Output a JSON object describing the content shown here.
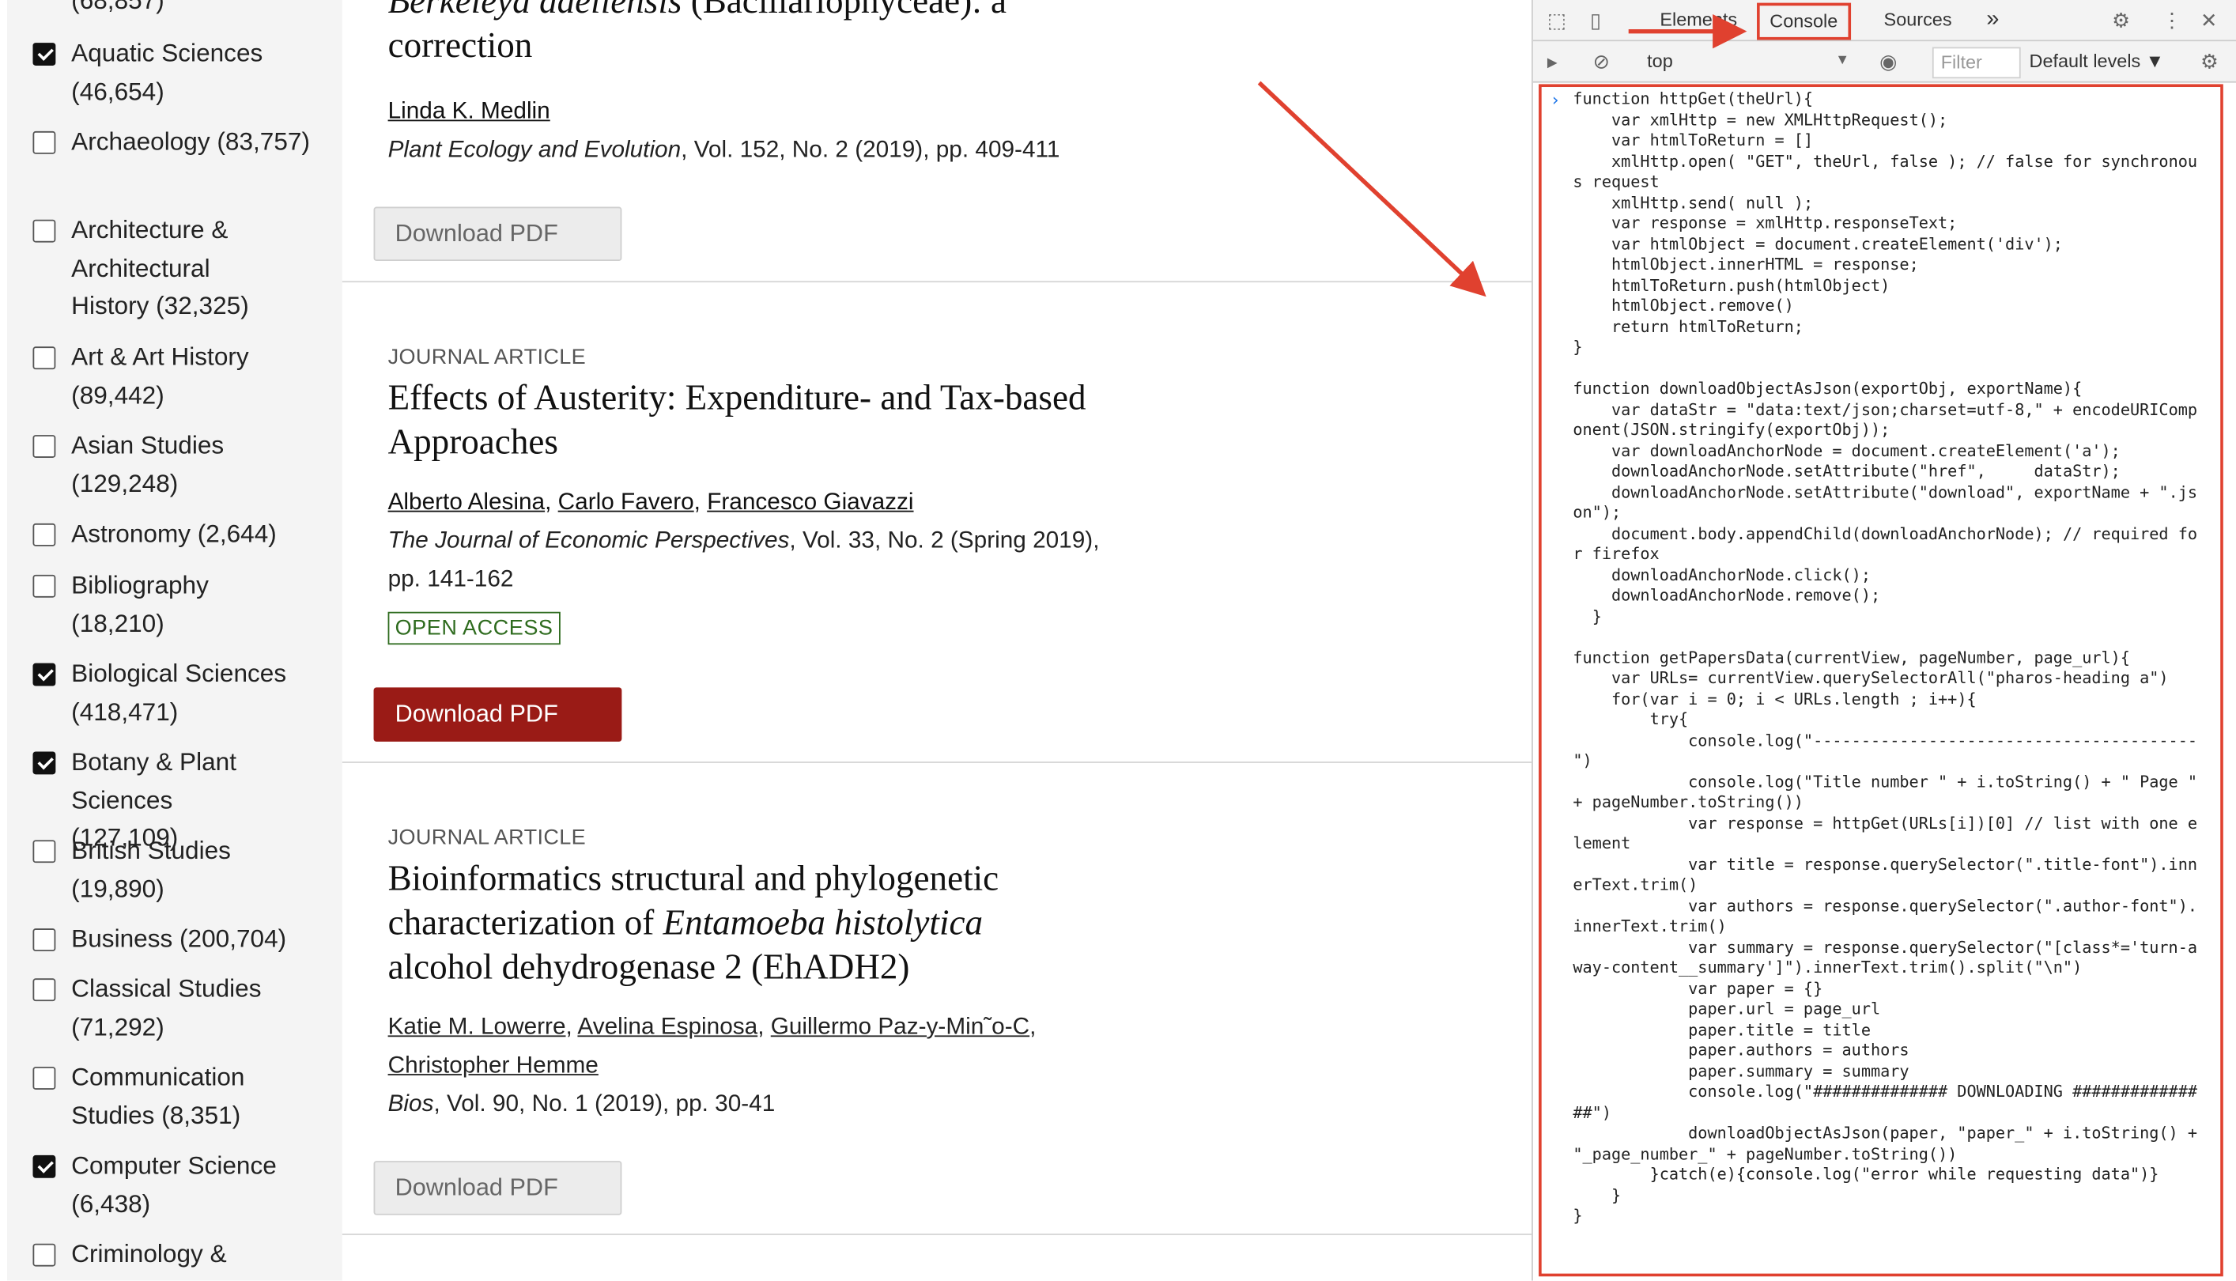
{
  "sidebar": {
    "filters": [
      {
        "label": "(68,857)",
        "checked": true
      },
      {
        "label": "Aquatic Sciences (46,654)",
        "checked": true
      },
      {
        "label": "Archaeology (83,757)",
        "checked": false
      },
      {
        "label": "Architecture & Architectural History (32,325)",
        "checked": false
      },
      {
        "label": "Art & Art History (89,442)",
        "checked": false
      },
      {
        "label": "Asian Studies (129,248)",
        "checked": false
      },
      {
        "label": "Astronomy (2,644)",
        "checked": false
      },
      {
        "label": "Bibliography (18,210)",
        "checked": false
      },
      {
        "label": "Biological Sciences (418,471)",
        "checked": true
      },
      {
        "label": "Botany & Plant Sciences (127,109)",
        "checked": true
      },
      {
        "label": "British Studies (19,890)",
        "checked": false
      },
      {
        "label": "Business (200,704)",
        "checked": false
      },
      {
        "label": "Classical Studies (71,292)",
        "checked": false
      },
      {
        "label": "Communication Studies (8,351)",
        "checked": false
      },
      {
        "label": "Computer Science (6,438)",
        "checked": true
      },
      {
        "label": "Criminology &",
        "checked": false
      }
    ]
  },
  "results": [
    {
      "title_italic": "Berkeleya adeliensis",
      "title_rest": " (Bacillariophyceae): a correction",
      "authors": [
        "Linda K. Medlin"
      ],
      "journal": "Plant Ecology and Evolution",
      "cite_rest": ", Vol. 152, No. 2 (2019), pp. 409-411",
      "download_label": "Download PDF"
    },
    {
      "kind": "JOURNAL ARTICLE",
      "title": "Effects of Austerity: Expenditure- and Tax-based Approaches",
      "authors": [
        "Alberto Alesina",
        "Carlo Favero",
        "Francesco Giavazzi"
      ],
      "journal": "The Journal of Economic Perspectives",
      "cite_rest": ", Vol. 33, No. 2 (Spring 2019), pp. 141-162",
      "badge": "OPEN ACCESS",
      "download_label": "Download PDF"
    },
    {
      "kind": "JOURNAL ARTICLE",
      "title_before": "Bioinformatics structural and phylogenetic characterization of ",
      "title_italic": "Entamoeba histolytica",
      "title_after": " alcohol dehydrogenase 2 (EhADH2)",
      "authors": [
        "Katie M. Lowerre",
        "Avelina Espinosa",
        "Guillermo Paz-y-Min˜o-C",
        "Christopher Hemme"
      ],
      "journal": "Bios",
      "cite_rest": ", Vol. 90, No. 1 (2019), pp. 30-41",
      "download_label": "Download PDF"
    }
  ],
  "devtools": {
    "tabs": {
      "elements": "Elements",
      "console": "Console",
      "sources": "Sources",
      "more": "»"
    },
    "context": "top",
    "filter_placeholder": "Filter",
    "levels": "Default levels ▼",
    "code": "function httpGet(theUrl){\n    var xmlHttp = new XMLHttpRequest();\n    var htmlToReturn = []\n    xmlHttp.open( \"GET\", theUrl, false ); // false for synchronous request\n    xmlHttp.send( null );\n    var response = xmlHttp.responseText;\n    var htmlObject = document.createElement('div');\n    htmlObject.innerHTML = response;\n    htmlToReturn.push(htmlObject)\n    htmlObject.remove()\n    return htmlToReturn;\n}\n\nfunction downloadObjectAsJson(exportObj, exportName){\n    var dataStr = \"data:text/json;charset=utf-8,\" + encodeURIComponent(JSON.stringify(exportObj));\n    var downloadAnchorNode = document.createElement('a');\n    downloadAnchorNode.setAttribute(\"href\",     dataStr);\n    downloadAnchorNode.setAttribute(\"download\", exportName + \".json\");\n    document.body.appendChild(downloadAnchorNode); // required for firefox\n    downloadAnchorNode.click();\n    downloadAnchorNode.remove();\n  }\n\nfunction getPapersData(currentView, pageNumber, page_url){\n    var URLs= currentView.querySelectorAll(\"pharos-heading a\")\n    for(var i = 0; i < URLs.length ; i++){\n        try{\n            console.log(\"----------------------------------------\")\n            console.log(\"Title number \" + i.toString() + \" Page \" + pageNumber.toString())\n            var response = httpGet(URLs[i])[0] // list with one element\n            var title = response.querySelector(\".title-font\").innerText.trim()\n            var authors = response.querySelector(\".author-font\").innerText.trim()\n            var summary = response.querySelector(\"[class*='turn-away-content__summary']\").innerText.trim().split(\"\\n\")\n            var paper = {}\n            paper.url = page_url\n            paper.title = title\n            paper.authors = authors\n            paper.summary = summary\n            console.log(\"############## DOWNLOADING ###############\")\n            downloadObjectAsJson(paper, \"paper_\" + i.toString() + \"_page_number_\" + pageNumber.toString())\n        }catch(e){console.log(\"error while requesting data\")}\n    }\n}"
  },
  "colors": {
    "accent_red": "#e0412f",
    "download_red": "#9a1b16",
    "open_access_green": "#2e6b1e"
  }
}
